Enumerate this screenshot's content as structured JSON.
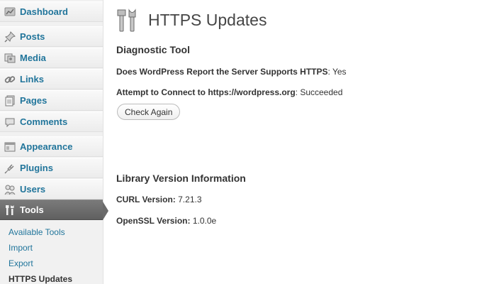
{
  "sidebar": {
    "items": [
      {
        "label": "Dashboard",
        "icon": "dashboard-icon"
      },
      {
        "label": "Posts",
        "icon": "pushpin-icon"
      },
      {
        "label": "Media",
        "icon": "media-icon"
      },
      {
        "label": "Links",
        "icon": "link-icon"
      },
      {
        "label": "Pages",
        "icon": "pages-icon"
      },
      {
        "label": "Comments",
        "icon": "comment-icon"
      },
      {
        "label": "Appearance",
        "icon": "appearance-icon"
      },
      {
        "label": "Plugins",
        "icon": "plugin-icon"
      },
      {
        "label": "Users",
        "icon": "users-icon"
      },
      {
        "label": "Tools",
        "icon": "tools-icon",
        "current": true
      }
    ],
    "submenu": [
      {
        "label": "Available Tools"
      },
      {
        "label": "Import"
      },
      {
        "label": "Export"
      },
      {
        "label": "HTTPS Updates",
        "active": true
      }
    ]
  },
  "page": {
    "title": "HTTPS Updates",
    "diagnostic": {
      "heading": "Diagnostic Tool",
      "report_label": "Does WordPress Report the Server Supports HTTPS",
      "report_value": ": Yes",
      "connect_label": "Attempt to Connect to https://wordpress.org",
      "connect_value": ": Succeeded",
      "button_label": "Check Again"
    },
    "library": {
      "heading": "Library Version Information",
      "curl_label": "CURL Version:",
      "curl_value": " 7.21.3",
      "openssl_label": "OpenSSL Version:",
      "openssl_value": " 1.0.0e"
    }
  },
  "colors": {
    "link": "#21759b",
    "current_menu_bg": "#6a6a6a",
    "sidebar_bg": "#f1f1f1"
  }
}
